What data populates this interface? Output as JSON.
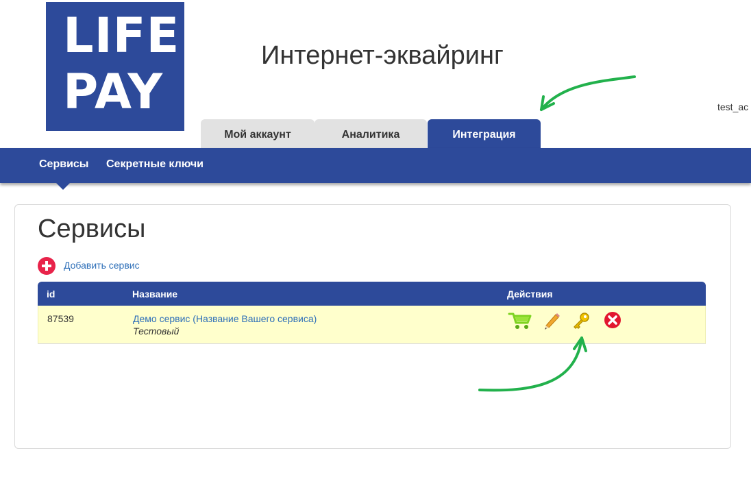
{
  "logo": {
    "line1": "LIFE",
    "line2": "PAY",
    "color": "#2d4a9a"
  },
  "header": {
    "title": "Интернет-эквайринг",
    "user": "test_ac"
  },
  "tabs": [
    {
      "label": "Мой аккаунт",
      "active": false
    },
    {
      "label": "Аналитика",
      "active": false
    },
    {
      "label": "Интеграция",
      "active": true
    }
  ],
  "subnav": {
    "items": [
      {
        "label": "Сервисы",
        "active": true
      },
      {
        "label": "Секретные ключи",
        "active": false
      }
    ]
  },
  "main": {
    "title": "Сервисы",
    "add_label": "Добавить сервис",
    "table": {
      "columns": [
        "id",
        "Название",
        "Действия"
      ],
      "rows": [
        {
          "id": "87539",
          "name": "Демо сервис (Название Вашего сервиса)",
          "type": "Тестовый",
          "actions": [
            "cart-icon",
            "pencil-icon",
            "key-icon",
            "delete-icon"
          ]
        }
      ]
    }
  },
  "colors": {
    "brand": "#2d4a9a",
    "link": "#2e6fb8",
    "row_highlight": "#ffffcc",
    "add_icon": "#e8234a",
    "annotation_arrow": "#22b14c"
  }
}
